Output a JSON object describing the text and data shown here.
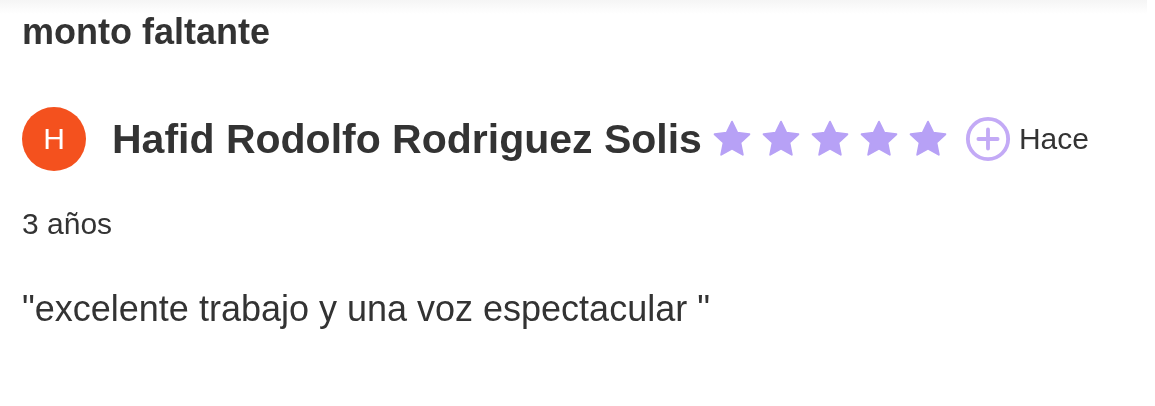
{
  "heading": "monto faltante",
  "review": {
    "avatar_letter": "H",
    "color": "#f4511e",
    "author": "Hafid Rodolfo Rodriguez Solis",
    "stars": 5,
    "time_lines": [
      "Hace",
      "3 años"
    ],
    "comment": "\"excelente trabajo y una voz espectacular \""
  }
}
